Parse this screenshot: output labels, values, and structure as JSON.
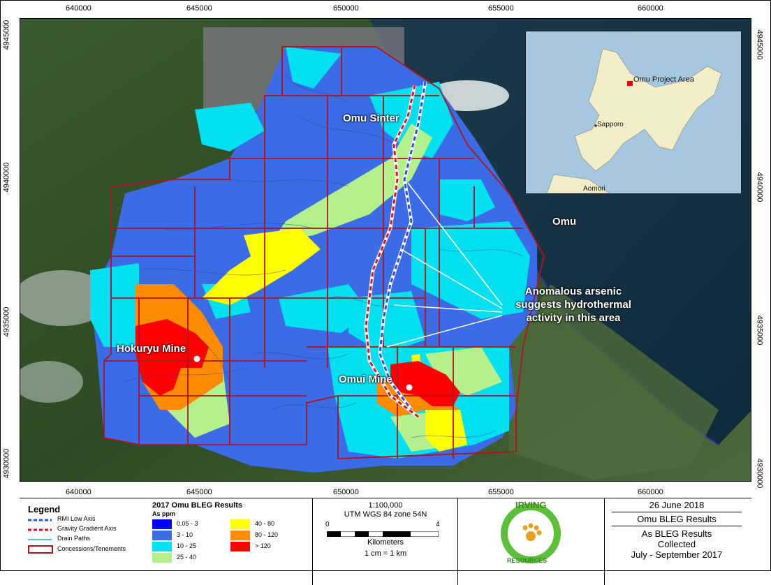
{
  "map": {
    "grid": {
      "top_x_labels": [
        "640000",
        "645000",
        "650000",
        "655000",
        "660000"
      ],
      "bottom_x_labels": [
        "640000",
        "645000",
        "650000",
        "655000",
        "660000"
      ],
      "left_y_labels": [
        "4945000",
        "4940000",
        "4935000",
        "4930000"
      ],
      "right_y_labels": [
        "4945000",
        "4940000",
        "4935000",
        "4930000"
      ]
    },
    "labels": {
      "omu_sinter": "Omu Sinter",
      "hokuryu_mine": "Hokuryu Mine",
      "omui_mine": "Omui Mine",
      "omu": "Omu",
      "annotation": [
        "Anomalous arsenic",
        "suggests hydrothermal",
        "activity in this area"
      ]
    },
    "inset": {
      "project_label": "Omu Project Area",
      "sapporo": "Sapporo",
      "aomori": "Aomori"
    },
    "colors": {
      "class_0_05_3": "#0000ff",
      "class_3_10": "#3b6ce6",
      "class_10_25": "#00e0f0",
      "class_25_40": "#b4f08c",
      "class_40_80": "#ffff00",
      "class_80_120": "#ff8c00",
      "class_gt_120": "#ff0000",
      "tenement": "#b2121c"
    }
  },
  "legend": {
    "title": "Legend",
    "items": [
      "RMI Low Axis",
      "Gravity Gradient Axis",
      "Drain Paths",
      "Concessions/Tenements"
    ]
  },
  "results": {
    "title": "2017 Omu BLEG Results",
    "unit": "As ppm",
    "classes": [
      "0.05 - 3",
      "3 - 10",
      "10 - 25",
      "25 - 40",
      "40 - 80",
      "80 - 120",
      "> 120"
    ]
  },
  "scale": {
    "ratio": "1:100,000",
    "projection": "UTM WGS 84 zone 54N",
    "tick_start": "0",
    "tick_end": "4",
    "units": "Kilometers",
    "equivalence": "1 cm = 1 km"
  },
  "logo": {
    "text_top": "IRVING",
    "text_bottom": "RESOURCES"
  },
  "info": {
    "date": "26 June 2018",
    "title": "Omu BLEG Results",
    "subtitle": [
      "As BLEG Results",
      "Collected",
      "July - September 2017"
    ]
  }
}
